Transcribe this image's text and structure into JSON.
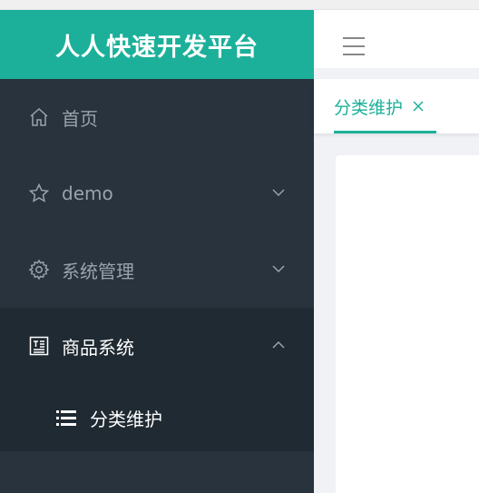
{
  "app": {
    "title": "人人快速开发平台"
  },
  "sidebar": {
    "items": [
      {
        "label": "首页",
        "icon": "home-icon"
      },
      {
        "label": "demo",
        "icon": "star-icon",
        "arrow": "chevron-down-icon"
      },
      {
        "label": "系统管理",
        "icon": "gear-icon",
        "arrow": "chevron-down-icon"
      },
      {
        "label": "商品系统",
        "icon": "document-icon",
        "arrow": "chevron-up-icon",
        "expanded": true,
        "children": [
          {
            "label": "分类维护",
            "icon": "list-icon"
          }
        ]
      }
    ]
  },
  "header": {
    "menu_toggle_icon": "hamburger-icon"
  },
  "tabs": [
    {
      "label": "分类维护",
      "active": true,
      "close_icon": "close-icon"
    }
  ],
  "colors": {
    "brand": "#1cb09a",
    "sidebar_bg": "#28333e",
    "sidebar_active_bg": "#1f2a32",
    "sidebar_text": "#9aa3ab"
  }
}
